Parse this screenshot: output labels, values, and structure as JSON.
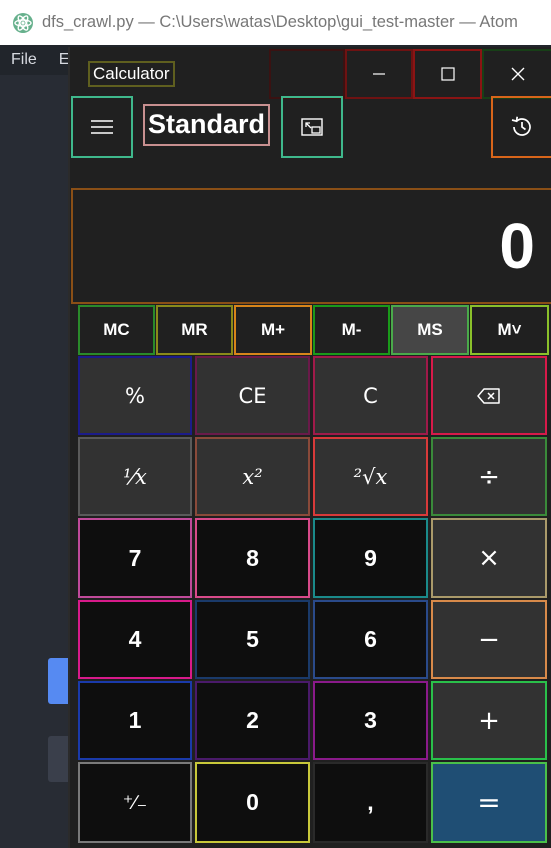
{
  "atom": {
    "title": "dfs_crawl.py — C:\\Users\\watas\\Desktop\\gui_test-master — Atom",
    "menu": [
      "File",
      "Ed"
    ]
  },
  "calculator": {
    "title": "Calculator",
    "mode": "Standard",
    "display": "0",
    "memory": [
      "MC",
      "MR",
      "M+",
      "M-",
      "MS",
      "M˅"
    ],
    "keys": {
      "percent": "%",
      "ce": "CE",
      "c": "C",
      "reciprocal": "⅟x",
      "square": "x²",
      "sqrt": "²√x",
      "divide": "÷",
      "multiply": "×",
      "minus": "−",
      "plus": "+",
      "negate": "⁺∕₋",
      "decimal": ",",
      "equals": "=",
      "n0": "0",
      "n1": "1",
      "n2": "2",
      "n3": "3",
      "n4": "4",
      "n5": "5",
      "n6": "6",
      "n7": "7",
      "n8": "8",
      "n9": "9"
    }
  },
  "colors": {
    "titlebar_bg": "#202020",
    "number_key_bg": "#0e0e0e",
    "op_key_bg": "#323232",
    "equals_bg": "#1f4e74"
  }
}
